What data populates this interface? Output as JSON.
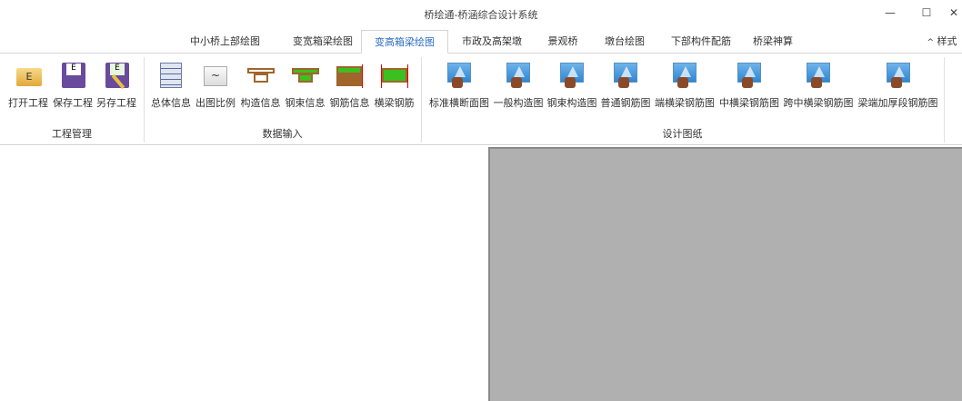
{
  "window": {
    "title": "桥绘通-桥涵综合设计系统",
    "minimize": "—",
    "maximize": "☐",
    "close": "✕"
  },
  "tabs": [
    {
      "label": "中小桥上部绘图",
      "active": false
    },
    {
      "label": "变宽箱梁绘图",
      "active": false
    },
    {
      "label": "变高箱梁绘图",
      "active": true
    },
    {
      "label": "市政及高架墩",
      "active": false
    },
    {
      "label": "景观桥",
      "active": false
    },
    {
      "label": "墩台绘图",
      "active": false
    },
    {
      "label": "下部构件配筋",
      "active": false
    },
    {
      "label": "桥梁神算",
      "active": false
    }
  ],
  "style_menu": {
    "icon": "^",
    "label": "样式"
  },
  "groups": {
    "project": {
      "label": "工程管理",
      "items": [
        "打开工程",
        "保存工程",
        "另存工程"
      ]
    },
    "input": {
      "label": "数据输入",
      "items": [
        "总体信息",
        "出图比例",
        "构造信息",
        "钢束信息",
        "钢筋信息",
        "横梁钢筋"
      ]
    },
    "drawings": {
      "label": "设计图纸",
      "items": [
        "标准横断面图",
        "一般构造图",
        "钢束构造图",
        "普通钢筋图",
        "端横梁钢筋图",
        "中横梁钢筋图",
        "跨中横梁钢筋图",
        "梁端加厚段钢筋图"
      ]
    }
  },
  "colors": {
    "active_tab": "#2b6cc4",
    "canvas": "#b0b0b0"
  }
}
